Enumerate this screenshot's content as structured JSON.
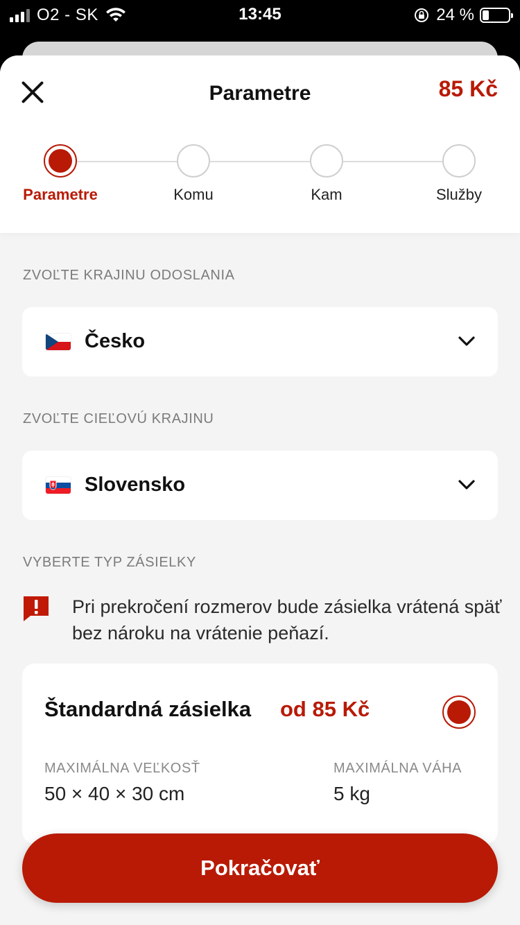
{
  "status_bar": {
    "carrier": "O2 - SK",
    "time": "13:45",
    "battery": "24 %",
    "battery_level": 0.24
  },
  "header": {
    "title": "Parametre",
    "price": "85 Kč",
    "close_icon": "close-icon"
  },
  "steps": [
    {
      "label": "Parametre",
      "active": true
    },
    {
      "label": "Komu",
      "active": false
    },
    {
      "label": "Kam",
      "active": false
    },
    {
      "label": "Služby",
      "active": false
    }
  ],
  "origin": {
    "section_label": "ZVOĽTE KRAJINU ODOSLANIA",
    "value": "Česko",
    "flag": "czech-flag-icon"
  },
  "destination": {
    "section_label": "ZVOĽTE CIEĽOVÚ KRAJINU",
    "value": "Slovensko",
    "flag": "slovak-flag-icon"
  },
  "shipment_type": {
    "section_label": "VYBERTE TYP ZÁSIELKY",
    "warning": "Pri prekročení rozmerov bude zásielka vrátená späť bez nároku na vrátenie peňazí.",
    "card": {
      "title": "Štandardná zásielka",
      "price": "od 85 Kč",
      "selected": true,
      "size_label": "MAXIMÁLNA VEĽKOSŤ",
      "size_value": "50 × 40 × 30 cm",
      "weight_label": "MAXIMÁLNA VÁHA",
      "weight_value": "5 kg"
    }
  },
  "continue_button": "Pokračovať",
  "colors": {
    "accent": "#b81a06",
    "background": "#f4f4f4"
  }
}
